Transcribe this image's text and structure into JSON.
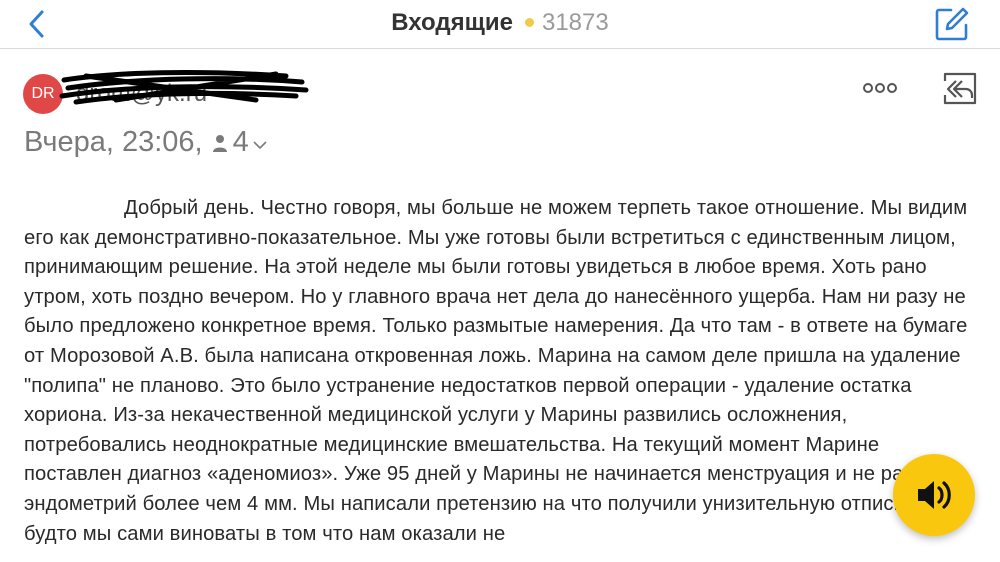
{
  "header": {
    "title": "Входящие",
    "count": "31873",
    "dot_color": "#f2c94c"
  },
  "message": {
    "avatar_initials": "DR",
    "avatar_color": "#e04747",
    "sender": "drom@yk.ru",
    "date": "Вчера, 23:06,",
    "recipients_count": "4",
    "body": "Добрый день. Честно говоря, мы больше не можем терпеть такое отношение. Мы видим его как демонстративно-показательное. Мы уже готовы были встретиться с единственным лицом, принимающим решение. На этой неделе мы были готовы увидеться в любое время. Хоть рано утром, хоть поздно вечером. Но у главного врача нет дела до нанесённого ущерба. Нам ни разу не было предложено конкретное время. Только размытые намерения. Да что там - в ответе на бумаге от Морозовой А.В. была написана откровенная ложь. Марина на самом деле пришла на удаление \"полипа\" не планово. Это было устранение недостатков первой операции - удаление остатка хориона. Из-за некачественной медицинской услуги у Марины развились осложнения, потребовались неоднократные медицинские вмешательства. На текущий момент Марине поставлен диагноз «аденомиоз». Уже 95 дней у Марины не начинается менструация и не растёт эндометрий более чем 4 мм. Мы написали претензию на что получили унизительную отписку, как будто мы сами виноваты в том что нам оказали не"
  },
  "icons": {
    "back": "chevron-left-icon",
    "compose": "compose-icon",
    "more": "more-dots-icon",
    "reply_all": "reply-all-icon",
    "recipients": "person-icon",
    "expand": "chevron-down-icon",
    "audio": "speaker-icon"
  },
  "accent_color": "#2f7fd1",
  "audio_button_color": "#f9c80e"
}
